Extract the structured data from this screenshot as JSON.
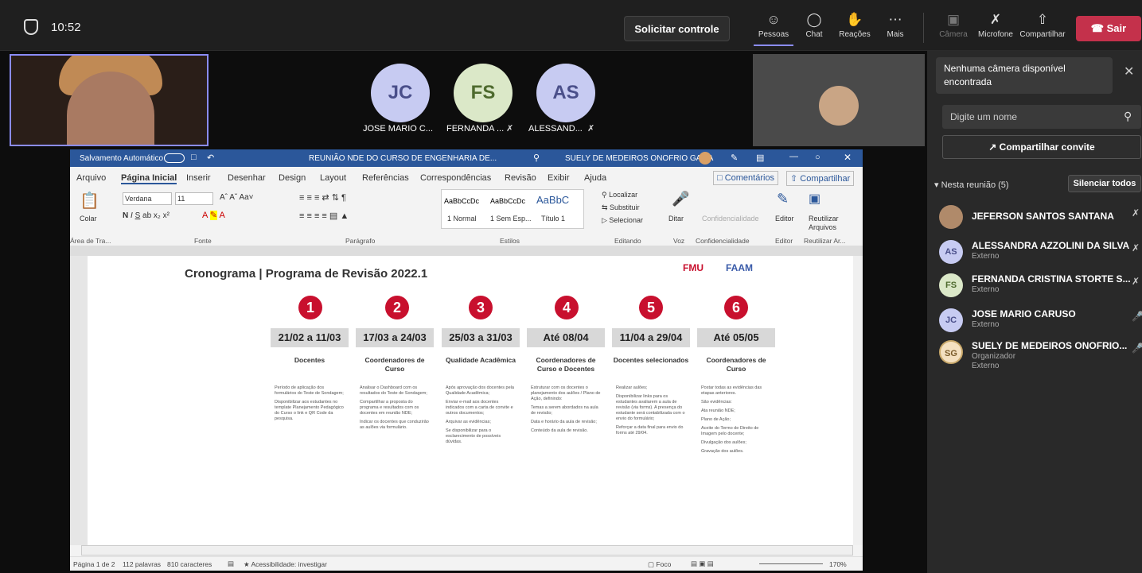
{
  "topbar": {
    "clock": "10:52",
    "request_control": "Solicitar controle",
    "people": "Pessoas",
    "chat": "Chat",
    "reactions": "Reações",
    "more": "Mais",
    "camera": "Câmera",
    "mic": "Microfone",
    "share": "Compartilhar",
    "leave": "Sair"
  },
  "stage": {
    "participants": [
      {
        "initials": "JC",
        "label": "JOSE MARIO C..."
      },
      {
        "initials": "FS",
        "label": "FERNANDA ..."
      },
      {
        "initials": "AS",
        "label": "ALESSAND..."
      }
    ]
  },
  "word": {
    "autosave": "Salvamento Automático",
    "doc_name": "REUNIÃO NDE DO CURSO DE ENGENHARIA DE...",
    "user": "SUELY DE MEDEIROS ONOFRIO GAMA",
    "menu": [
      "Arquivo",
      "Página Inicial",
      "Inserir",
      "Desenhar",
      "Design",
      "Layout",
      "Referências",
      "Correspondências",
      "Revisão",
      "Exibir",
      "Ajuda"
    ],
    "comments": "Comentários",
    "share": "Compartilhar",
    "font": "Verdana",
    "size": "11",
    "styles": [
      "1 Normal",
      "1 Sem Esp...",
      "Título 1"
    ],
    "style_sample": "AaBbCcDc",
    "find": "Localizar",
    "replace": "Substituir",
    "select": "Selecionar",
    "groups": {
      "clipboard": "Área de Tra...",
      "font": "Fonte",
      "paragraph": "Parágrafo",
      "styles": "Estilos",
      "editing": "Editando",
      "voice": "Voz",
      "sensitivity": "Confidencialidade",
      "editor": "Editor",
      "reuse": "Reutilizar Ar..."
    },
    "buttons": {
      "paste": "Colar",
      "dictate": "Ditar",
      "sensitivity": "Confidencialidade",
      "editor": "Editor",
      "reuse": "Reutilizar Arquivos"
    },
    "status": {
      "page": "Página 1 de 2",
      "words": "112 palavras",
      "chars": "810 caracteres",
      "accessibility": "Acessibilidade: investigar",
      "focus": "Foco",
      "zoom": "170%"
    }
  },
  "doc": {
    "title": "Cronograma | Programa de Revisão 2022.1",
    "logo1": "FMU",
    "logo2": "FAAM",
    "steps": [
      {
        "num": "1",
        "date": "21/02 a 11/03",
        "role": "Docentes",
        "bullets": [
          "Período de aplicação dos formulários do Teste de Sondagem;",
          "Disponibilizar aos estudantes no template Planejamento Pedagógico do Curso o link e QR Code da pesquisa."
        ]
      },
      {
        "num": "2",
        "date": "17/03 a 24/03",
        "role": "Coordenadores de Curso",
        "bullets": [
          "Analisar o Dashboard com os resultados do Teste de Sondagem;",
          "Compartilhar a proposta do programa e resultados com os docentes em reunião NDE;",
          "Indicar os docentes que conduzirão as aulões via formulário."
        ]
      },
      {
        "num": "3",
        "date": "25/03 a 31/03",
        "role": "Qualidade Acadêmica",
        "bullets": [
          "Após aprovação dos docentes pela Qualidade Acadêmica;",
          "Enviar e-mail aos docentes indicados com a carta de convite e outros documentos;",
          "Arquivar as evidências;",
          "Se disponibilizar para o esclarecimento de possíveis dúvidas."
        ]
      },
      {
        "num": "4",
        "date": "Até 08/04",
        "role": "Coordenadores de Curso e Docentes",
        "bullets": [
          "Estruturar com os docentes o planejamento dos aulões / Plano de Ação, definindo:",
          "Temas a serem abordados na aula de revisão;",
          "Data e horário da aula de revisão;",
          "Conteúdo da aula de revisão."
        ]
      },
      {
        "num": "5",
        "date": "11/04 a 29/04",
        "role": "Docentes selecionados",
        "bullets": [
          "Realizar aulões;",
          "Disponibilizar links para os estudantes avaliarem a aula de revisão (via forms). A presença do estudante será contabilizada com o envio do formulário;",
          "Reforçar a data final para envio do forms até 29/04."
        ]
      },
      {
        "num": "6",
        "date": "Até 05/05",
        "role": "Coordenadores de Curso",
        "bullets": [
          "Postar todas as evidências das etapas anteriores.",
          "São evidências:",
          "Ata reunião NDE;",
          "Plano de Ação;",
          "Aceite do Termo de Direito de Imagem pelo docente;",
          "Divulgação dos aulões;",
          "Gravação dos aulões."
        ]
      }
    ]
  },
  "panel": {
    "notice": "Nenhuma câmera disponível encontrada",
    "search_placeholder": "Digite um nome",
    "invite": "Compartilhar convite",
    "in_meeting": "Nesta reunião (5)",
    "mute_all": "Silenciar todos",
    "people": [
      {
        "initials": "",
        "name": "JEFERSON SANTOS SANTANA",
        "sub": "",
        "sub2": ""
      },
      {
        "initials": "AS",
        "name": "ALESSANDRA AZZOLINI DA SILVA",
        "sub": "Externo",
        "sub2": ""
      },
      {
        "initials": "FS",
        "name": "FERNANDA CRISTINA STORTE S...",
        "sub": "Externo",
        "sub2": ""
      },
      {
        "initials": "JC",
        "name": "JOSE MARIO CARUSO",
        "sub": "Externo",
        "sub2": ""
      },
      {
        "initials": "SG",
        "name": "SUELY DE MEDEIROS ONOFRIO...",
        "sub": "Organizador",
        "sub2": "Externo"
      }
    ]
  },
  "colors": {
    "accent": "#8b8cf8",
    "leave": "#c4314b",
    "word_blue": "#2b579a",
    "step_red": "#c8102e"
  }
}
